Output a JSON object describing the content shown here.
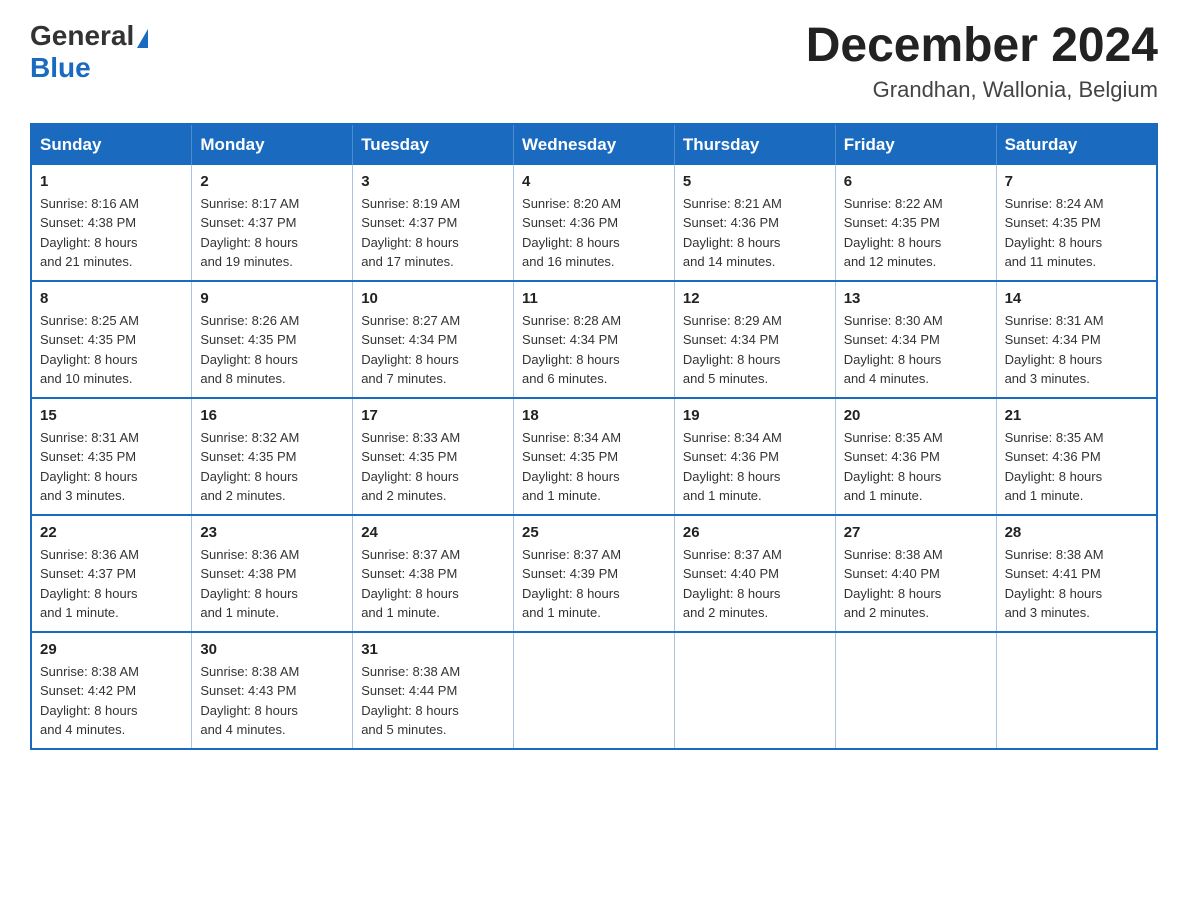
{
  "header": {
    "logo": {
      "general": "General",
      "blue": "Blue",
      "triangle": "▲"
    },
    "title": "December 2024",
    "location": "Grandhan, Wallonia, Belgium"
  },
  "days_of_week": [
    "Sunday",
    "Monday",
    "Tuesday",
    "Wednesday",
    "Thursday",
    "Friday",
    "Saturday"
  ],
  "weeks": [
    [
      {
        "day": "1",
        "sunrise": "8:16 AM",
        "sunset": "4:38 PM",
        "daylight": "8 hours and 21 minutes."
      },
      {
        "day": "2",
        "sunrise": "8:17 AM",
        "sunset": "4:37 PM",
        "daylight": "8 hours and 19 minutes."
      },
      {
        "day": "3",
        "sunrise": "8:19 AM",
        "sunset": "4:37 PM",
        "daylight": "8 hours and 17 minutes."
      },
      {
        "day": "4",
        "sunrise": "8:20 AM",
        "sunset": "4:36 PM",
        "daylight": "8 hours and 16 minutes."
      },
      {
        "day": "5",
        "sunrise": "8:21 AM",
        "sunset": "4:36 PM",
        "daylight": "8 hours and 14 minutes."
      },
      {
        "day": "6",
        "sunrise": "8:22 AM",
        "sunset": "4:35 PM",
        "daylight": "8 hours and 12 minutes."
      },
      {
        "day": "7",
        "sunrise": "8:24 AM",
        "sunset": "4:35 PM",
        "daylight": "8 hours and 11 minutes."
      }
    ],
    [
      {
        "day": "8",
        "sunrise": "8:25 AM",
        "sunset": "4:35 PM",
        "daylight": "8 hours and 10 minutes."
      },
      {
        "day": "9",
        "sunrise": "8:26 AM",
        "sunset": "4:35 PM",
        "daylight": "8 hours and 8 minutes."
      },
      {
        "day": "10",
        "sunrise": "8:27 AM",
        "sunset": "4:34 PM",
        "daylight": "8 hours and 7 minutes."
      },
      {
        "day": "11",
        "sunrise": "8:28 AM",
        "sunset": "4:34 PM",
        "daylight": "8 hours and 6 minutes."
      },
      {
        "day": "12",
        "sunrise": "8:29 AM",
        "sunset": "4:34 PM",
        "daylight": "8 hours and 5 minutes."
      },
      {
        "day": "13",
        "sunrise": "8:30 AM",
        "sunset": "4:34 PM",
        "daylight": "8 hours and 4 minutes."
      },
      {
        "day": "14",
        "sunrise": "8:31 AM",
        "sunset": "4:34 PM",
        "daylight": "8 hours and 3 minutes."
      }
    ],
    [
      {
        "day": "15",
        "sunrise": "8:31 AM",
        "sunset": "4:35 PM",
        "daylight": "8 hours and 3 minutes."
      },
      {
        "day": "16",
        "sunrise": "8:32 AM",
        "sunset": "4:35 PM",
        "daylight": "8 hours and 2 minutes."
      },
      {
        "day": "17",
        "sunrise": "8:33 AM",
        "sunset": "4:35 PM",
        "daylight": "8 hours and 2 minutes."
      },
      {
        "day": "18",
        "sunrise": "8:34 AM",
        "sunset": "4:35 PM",
        "daylight": "8 hours and 1 minute."
      },
      {
        "day": "19",
        "sunrise": "8:34 AM",
        "sunset": "4:36 PM",
        "daylight": "8 hours and 1 minute."
      },
      {
        "day": "20",
        "sunrise": "8:35 AM",
        "sunset": "4:36 PM",
        "daylight": "8 hours and 1 minute."
      },
      {
        "day": "21",
        "sunrise": "8:35 AM",
        "sunset": "4:36 PM",
        "daylight": "8 hours and 1 minute."
      }
    ],
    [
      {
        "day": "22",
        "sunrise": "8:36 AM",
        "sunset": "4:37 PM",
        "daylight": "8 hours and 1 minute."
      },
      {
        "day": "23",
        "sunrise": "8:36 AM",
        "sunset": "4:38 PM",
        "daylight": "8 hours and 1 minute."
      },
      {
        "day": "24",
        "sunrise": "8:37 AM",
        "sunset": "4:38 PM",
        "daylight": "8 hours and 1 minute."
      },
      {
        "day": "25",
        "sunrise": "8:37 AM",
        "sunset": "4:39 PM",
        "daylight": "8 hours and 1 minute."
      },
      {
        "day": "26",
        "sunrise": "8:37 AM",
        "sunset": "4:40 PM",
        "daylight": "8 hours and 2 minutes."
      },
      {
        "day": "27",
        "sunrise": "8:38 AM",
        "sunset": "4:40 PM",
        "daylight": "8 hours and 2 minutes."
      },
      {
        "day": "28",
        "sunrise": "8:38 AM",
        "sunset": "4:41 PM",
        "daylight": "8 hours and 3 minutes."
      }
    ],
    [
      {
        "day": "29",
        "sunrise": "8:38 AM",
        "sunset": "4:42 PM",
        "daylight": "8 hours and 4 minutes."
      },
      {
        "day": "30",
        "sunrise": "8:38 AM",
        "sunset": "4:43 PM",
        "daylight": "8 hours and 4 minutes."
      },
      {
        "day": "31",
        "sunrise": "8:38 AM",
        "sunset": "4:44 PM",
        "daylight": "8 hours and 5 minutes."
      },
      null,
      null,
      null,
      null
    ]
  ],
  "labels": {
    "sunrise": "Sunrise:",
    "sunset": "Sunset:",
    "daylight": "Daylight:"
  }
}
